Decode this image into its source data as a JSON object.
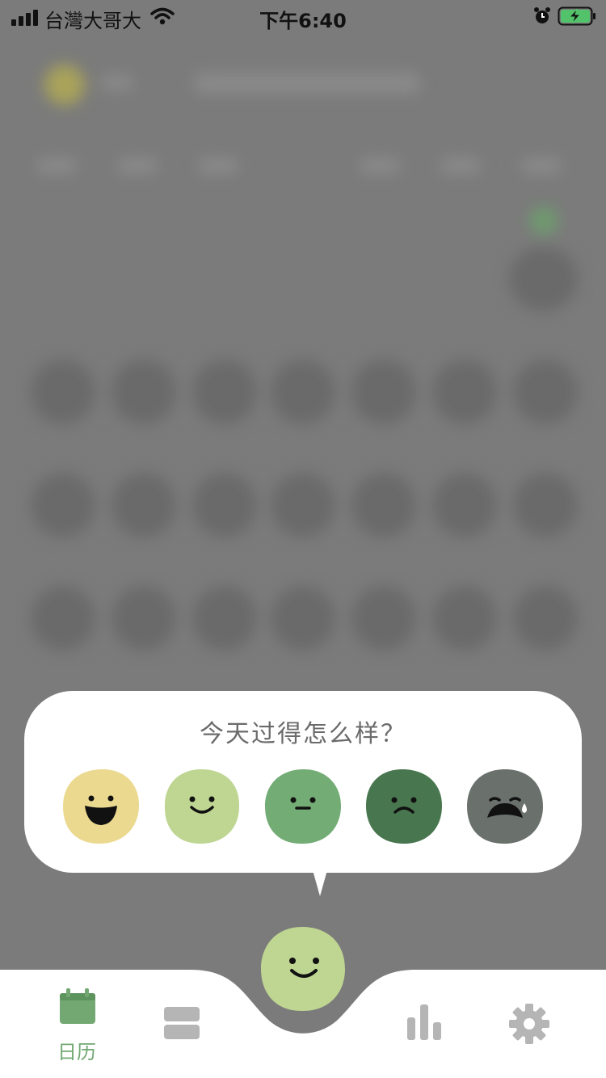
{
  "status_bar": {
    "carrier": "台灣大哥大",
    "time": "下午6:40"
  },
  "mood_prompt": {
    "title": "今天过得怎么样？",
    "options": [
      {
        "name": "rad",
        "color": "#ebd98f",
        "icon": "big-smile-face-icon"
      },
      {
        "name": "good",
        "color": "#bed692",
        "icon": "smile-face-icon"
      },
      {
        "name": "meh",
        "color": "#73ac75",
        "icon": "neutral-face-icon"
      },
      {
        "name": "bad",
        "color": "#48764f",
        "icon": "frown-face-icon"
      },
      {
        "name": "awful",
        "color": "#6a716d",
        "icon": "crying-face-icon"
      }
    ]
  },
  "tab_bar": {
    "calendar_label": "日历",
    "active_color": "#73a873",
    "inactive_color": "#b5b5b5",
    "center_button_color": "#bed692"
  }
}
